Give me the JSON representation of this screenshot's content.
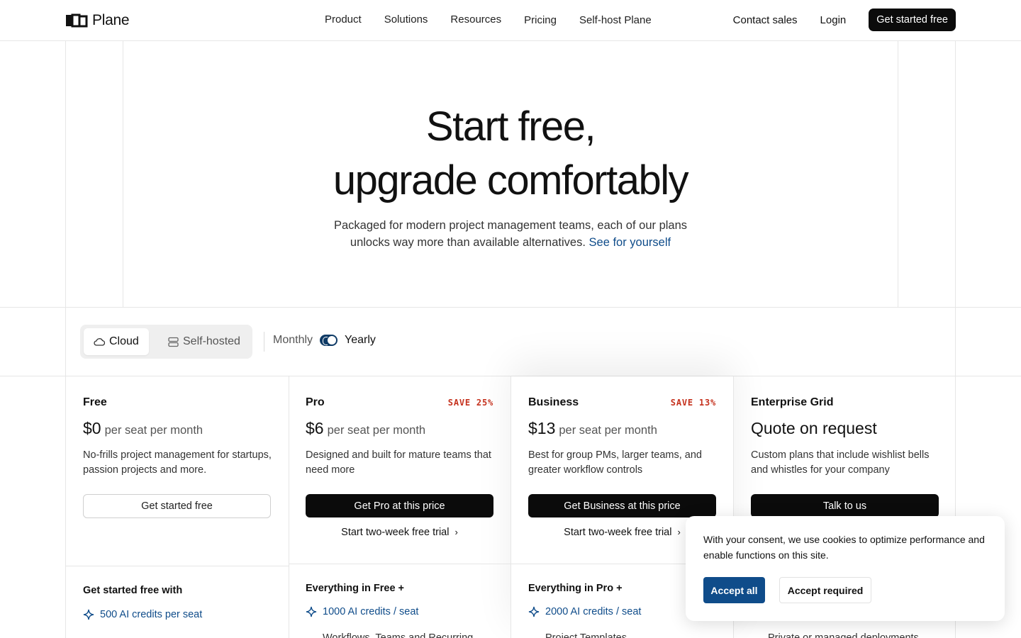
{
  "nav": {
    "logo_text": "Plane",
    "links": [
      "Product",
      "Solutions",
      "Resources",
      "Pricing",
      "Self-host Plane"
    ],
    "contact": "Contact sales",
    "login": "Login",
    "cta": "Get started free"
  },
  "hero": {
    "title_line1": "Start free,",
    "title_line2": "upgrade comfortably",
    "subtitle_line1": "Packaged for modern project management teams, each of our plans",
    "subtitle_line2": "unlocks way more than available alternatives.",
    "subtitle_link": "See for yourself"
  },
  "toggles": {
    "deploy_options": [
      "Cloud",
      "Self-hosted"
    ],
    "deploy_selected": "Cloud",
    "billing_monthly": "Monthly",
    "billing_yearly": "Yearly",
    "billing_selected": "Yearly"
  },
  "plans": [
    {
      "name": "Free",
      "save": "",
      "price": "$0",
      "per": "per seat per month",
      "desc": "No-frills project management for startups, passion projects and more.",
      "cta": "Get started free",
      "trial": "",
      "feature_head": "Get started free with",
      "feature_ai": "500 AI credits per seat",
      "feature_more": ""
    },
    {
      "name": "Pro",
      "save": "SAVE 25%",
      "price": "$6",
      "per": "per seat per month",
      "desc": "Designed and built for mature teams that need more",
      "cta": "Get Pro at this price",
      "trial": "Start two-week free trial",
      "feature_head": "Everything in Free +",
      "feature_ai": "1000 AI credits / seat",
      "feature_more": "Workflows, Teams and Recurring"
    },
    {
      "name": "Business",
      "save": "SAVE 13%",
      "price": "$13",
      "per": "per seat per month",
      "desc": "Best for group PMs, larger teams, and greater workflow controls",
      "cta": "Get Business at this price",
      "trial": "Start two-week free trial",
      "feature_head": "Everything in Pro +",
      "feature_ai": "2000 AI credits / seat",
      "feature_more": "Project Templates"
    },
    {
      "name": "Enterprise Grid",
      "save": "",
      "price": "Quote on request",
      "per": "",
      "desc": "Custom plans that include wishlist bells and whistles for your company",
      "cta": "Talk to us",
      "trial": "",
      "feature_head": "",
      "feature_ai": "",
      "feature_more": "Private or managed deployments"
    }
  ],
  "cookie": {
    "text": "With your consent, we use cookies to optimize performance and enable functions on this site.",
    "accept_all": "Accept all",
    "accept_required": "Accept required"
  },
  "colors": {
    "accent_blue": "#0f4c8a",
    "save_red": "#c5311d",
    "dark_button": "#0b0b0b"
  }
}
